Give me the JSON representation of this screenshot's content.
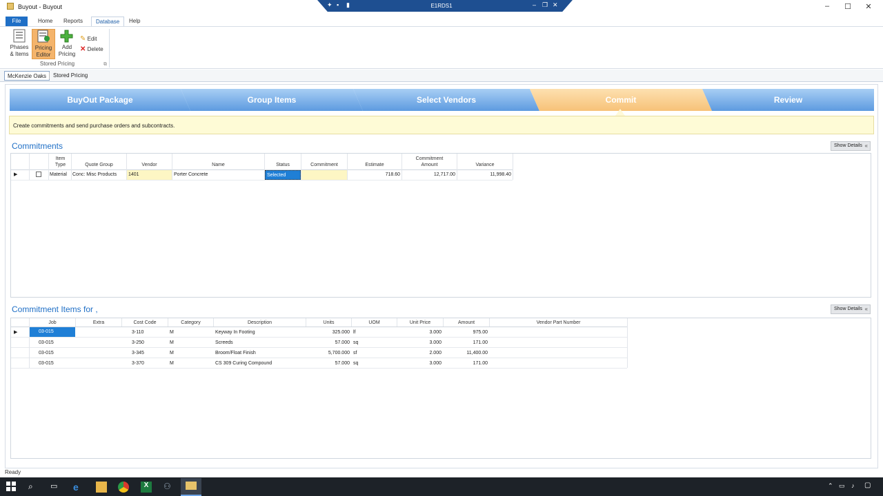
{
  "window": {
    "title": "Buyout - Buyout",
    "remote_session": "E1RDS1"
  },
  "menu": {
    "tabs": [
      "File",
      "Home",
      "Reports",
      "Database",
      "Help"
    ]
  },
  "ribbon": {
    "phases_items_label": "Phases\n& Items",
    "pricing_editor_label": "Pricing\nEditor",
    "add_pricing_label": "Add\nPricing",
    "edit_label": "Edit",
    "delete_label": "Delete",
    "group_label": "Stored Pricing"
  },
  "doc_tabs": [
    "McKenzie Oaks",
    "Stored Pricing"
  ],
  "wizard": {
    "steps": [
      "BuyOut Package",
      "Group Items",
      "Select Vendors",
      "Commit",
      "Review"
    ],
    "active_step": "Commit",
    "info": "Create commitments and send purchase orders and subcontracts."
  },
  "commitments": {
    "title": "Commitments",
    "show_details": "Show Details",
    "headers": [
      "Item\nType",
      "Quote Group",
      "Vendor",
      "Name",
      "Status",
      "Commitment",
      "Estimate",
      "Commitment\nAmount",
      "Variance"
    ],
    "rows": [
      {
        "item_type": "Material",
        "quote_group": "Conc: Misc Products",
        "vendor": "1401",
        "name": "Porter Concrete",
        "status": "Selected",
        "commitment": "",
        "estimate": "718.60",
        "commitment_amount": "12,717.00",
        "variance": "11,998.40"
      }
    ]
  },
  "items": {
    "title": "Commitment Items for ,",
    "show_details": "Show Details",
    "headers": [
      "Job",
      "Extra",
      "Cost Code",
      "Category",
      "Description",
      "Units",
      "UOM",
      "Unit Price",
      "Amount",
      "Vendor Part Number"
    ],
    "rows": [
      {
        "job": "03-015",
        "extra": "",
        "cost_code": "3-110",
        "category": "M",
        "description": "Keyway In Footing",
        "units": "325.000",
        "uom": "lf",
        "unit_price": "3.000",
        "amount": "975.00",
        "vpn": ""
      },
      {
        "job": "03-015",
        "extra": "",
        "cost_code": "3-250",
        "category": "M",
        "description": "Screeds",
        "units": "57.000",
        "uom": "sq",
        "unit_price": "3.000",
        "amount": "171.00",
        "vpn": ""
      },
      {
        "job": "03-015",
        "extra": "",
        "cost_code": "3-345",
        "category": "M",
        "description": "Broom/Float Finish",
        "units": "5,700.000",
        "uom": "sf",
        "unit_price": "2.000",
        "amount": "11,400.00",
        "vpn": ""
      },
      {
        "job": "03-015",
        "extra": "",
        "cost_code": "3-370",
        "category": "M",
        "description": "CS 309 Curing Compound",
        "units": "57.000",
        "uom": "sq",
        "unit_price": "3.000",
        "amount": "171.00",
        "vpn": ""
      }
    ]
  },
  "status_bar": {
    "text": "Ready"
  },
  "icons": [
    "phases-items-icon",
    "pricing-editor-icon",
    "add-pricing-icon",
    "edit-pencil-icon",
    "delete-x-icon",
    "show-details-chevron-icon"
  ],
  "colors": {
    "accent": "#1f6fc6",
    "active_step": "#f7c278",
    "step": "#5d9be0",
    "info_bar": "#fefbd6",
    "selected": "#1f7fd6"
  }
}
